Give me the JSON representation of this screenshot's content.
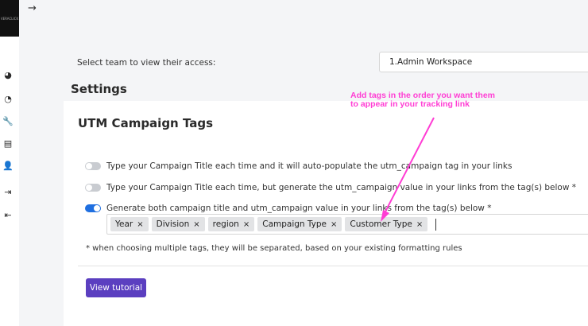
{
  "sidebar": {
    "logo_text": "VERACLICK",
    "nav": [
      {
        "icon": "dashboard-icon",
        "glyph": "◕"
      },
      {
        "icon": "pie-chart-icon",
        "glyph": "◔"
      },
      {
        "icon": "wrench-icon",
        "glyph": "🔧"
      },
      {
        "icon": "book-icon",
        "glyph": "▤"
      },
      {
        "icon": "user-icon",
        "glyph": "👤"
      },
      {
        "icon": "sign-in-icon",
        "glyph": "⇥"
      },
      {
        "icon": "sign-out-icon",
        "glyph": "⇤"
      }
    ]
  },
  "header": {
    "collapse_glyph": "→"
  },
  "team": {
    "label": "Select team to view their access:",
    "selected": "1.Admin Workspace"
  },
  "settings_title": "Settings",
  "utm": {
    "title": "UTM Campaign Tags",
    "options": [
      {
        "label": "Type your Campaign Title each time and it will auto-populate the utm_campaign tag in your links",
        "enabled": false
      },
      {
        "label": "Type your Campaign Title each time, but generate the utm_campaign value in your links from the tag(s) below *",
        "enabled": false
      },
      {
        "label": "Generate both campaign title and utm_campaign value in your links from the tag(s) below *",
        "enabled": true
      }
    ],
    "tags": [
      "Year",
      "Division",
      "region",
      "Campaign Type",
      "Customer Type"
    ],
    "remove_glyph": "×",
    "note": "* when choosing multiple tags, they will be separated, based on your existing formatting rules",
    "tutorial_button": "View tutorial"
  },
  "annotation": {
    "line1": "Add tags in the order you want them",
    "line2": "to appear in your tracking link",
    "color": "#ff3dd4"
  }
}
